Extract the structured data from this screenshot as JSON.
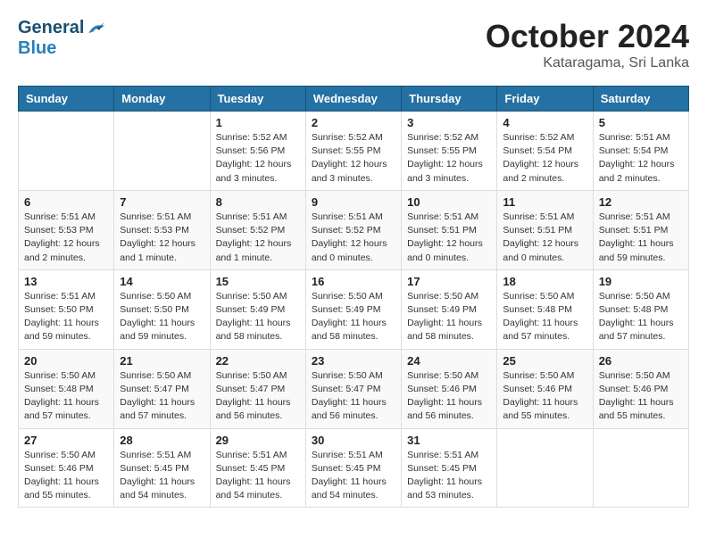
{
  "header": {
    "logo_general": "General",
    "logo_blue": "Blue",
    "month": "October 2024",
    "location": "Kataragama, Sri Lanka"
  },
  "weekdays": [
    "Sunday",
    "Monday",
    "Tuesday",
    "Wednesday",
    "Thursday",
    "Friday",
    "Saturday"
  ],
  "weeks": [
    [
      {
        "day": "",
        "info": ""
      },
      {
        "day": "",
        "info": ""
      },
      {
        "day": "1",
        "info": "Sunrise: 5:52 AM\nSunset: 5:56 PM\nDaylight: 12 hours\nand 3 minutes."
      },
      {
        "day": "2",
        "info": "Sunrise: 5:52 AM\nSunset: 5:55 PM\nDaylight: 12 hours\nand 3 minutes."
      },
      {
        "day": "3",
        "info": "Sunrise: 5:52 AM\nSunset: 5:55 PM\nDaylight: 12 hours\nand 3 minutes."
      },
      {
        "day": "4",
        "info": "Sunrise: 5:52 AM\nSunset: 5:54 PM\nDaylight: 12 hours\nand 2 minutes."
      },
      {
        "day": "5",
        "info": "Sunrise: 5:51 AM\nSunset: 5:54 PM\nDaylight: 12 hours\nand 2 minutes."
      }
    ],
    [
      {
        "day": "6",
        "info": "Sunrise: 5:51 AM\nSunset: 5:53 PM\nDaylight: 12 hours\nand 2 minutes."
      },
      {
        "day": "7",
        "info": "Sunrise: 5:51 AM\nSunset: 5:53 PM\nDaylight: 12 hours\nand 1 minute."
      },
      {
        "day": "8",
        "info": "Sunrise: 5:51 AM\nSunset: 5:52 PM\nDaylight: 12 hours\nand 1 minute."
      },
      {
        "day": "9",
        "info": "Sunrise: 5:51 AM\nSunset: 5:52 PM\nDaylight: 12 hours\nand 0 minutes."
      },
      {
        "day": "10",
        "info": "Sunrise: 5:51 AM\nSunset: 5:51 PM\nDaylight: 12 hours\nand 0 minutes."
      },
      {
        "day": "11",
        "info": "Sunrise: 5:51 AM\nSunset: 5:51 PM\nDaylight: 12 hours\nand 0 minutes."
      },
      {
        "day": "12",
        "info": "Sunrise: 5:51 AM\nSunset: 5:51 PM\nDaylight: 11 hours\nand 59 minutes."
      }
    ],
    [
      {
        "day": "13",
        "info": "Sunrise: 5:51 AM\nSunset: 5:50 PM\nDaylight: 11 hours\nand 59 minutes."
      },
      {
        "day": "14",
        "info": "Sunrise: 5:50 AM\nSunset: 5:50 PM\nDaylight: 11 hours\nand 59 minutes."
      },
      {
        "day": "15",
        "info": "Sunrise: 5:50 AM\nSunset: 5:49 PM\nDaylight: 11 hours\nand 58 minutes."
      },
      {
        "day": "16",
        "info": "Sunrise: 5:50 AM\nSunset: 5:49 PM\nDaylight: 11 hours\nand 58 minutes."
      },
      {
        "day": "17",
        "info": "Sunrise: 5:50 AM\nSunset: 5:49 PM\nDaylight: 11 hours\nand 58 minutes."
      },
      {
        "day": "18",
        "info": "Sunrise: 5:50 AM\nSunset: 5:48 PM\nDaylight: 11 hours\nand 57 minutes."
      },
      {
        "day": "19",
        "info": "Sunrise: 5:50 AM\nSunset: 5:48 PM\nDaylight: 11 hours\nand 57 minutes."
      }
    ],
    [
      {
        "day": "20",
        "info": "Sunrise: 5:50 AM\nSunset: 5:48 PM\nDaylight: 11 hours\nand 57 minutes."
      },
      {
        "day": "21",
        "info": "Sunrise: 5:50 AM\nSunset: 5:47 PM\nDaylight: 11 hours\nand 57 minutes."
      },
      {
        "day": "22",
        "info": "Sunrise: 5:50 AM\nSunset: 5:47 PM\nDaylight: 11 hours\nand 56 minutes."
      },
      {
        "day": "23",
        "info": "Sunrise: 5:50 AM\nSunset: 5:47 PM\nDaylight: 11 hours\nand 56 minutes."
      },
      {
        "day": "24",
        "info": "Sunrise: 5:50 AM\nSunset: 5:46 PM\nDaylight: 11 hours\nand 56 minutes."
      },
      {
        "day": "25",
        "info": "Sunrise: 5:50 AM\nSunset: 5:46 PM\nDaylight: 11 hours\nand 55 minutes."
      },
      {
        "day": "26",
        "info": "Sunrise: 5:50 AM\nSunset: 5:46 PM\nDaylight: 11 hours\nand 55 minutes."
      }
    ],
    [
      {
        "day": "27",
        "info": "Sunrise: 5:50 AM\nSunset: 5:46 PM\nDaylight: 11 hours\nand 55 minutes."
      },
      {
        "day": "28",
        "info": "Sunrise: 5:51 AM\nSunset: 5:45 PM\nDaylight: 11 hours\nand 54 minutes."
      },
      {
        "day": "29",
        "info": "Sunrise: 5:51 AM\nSunset: 5:45 PM\nDaylight: 11 hours\nand 54 minutes."
      },
      {
        "day": "30",
        "info": "Sunrise: 5:51 AM\nSunset: 5:45 PM\nDaylight: 11 hours\nand 54 minutes."
      },
      {
        "day": "31",
        "info": "Sunrise: 5:51 AM\nSunset: 5:45 PM\nDaylight: 11 hours\nand 53 minutes."
      },
      {
        "day": "",
        "info": ""
      },
      {
        "day": "",
        "info": ""
      }
    ]
  ]
}
